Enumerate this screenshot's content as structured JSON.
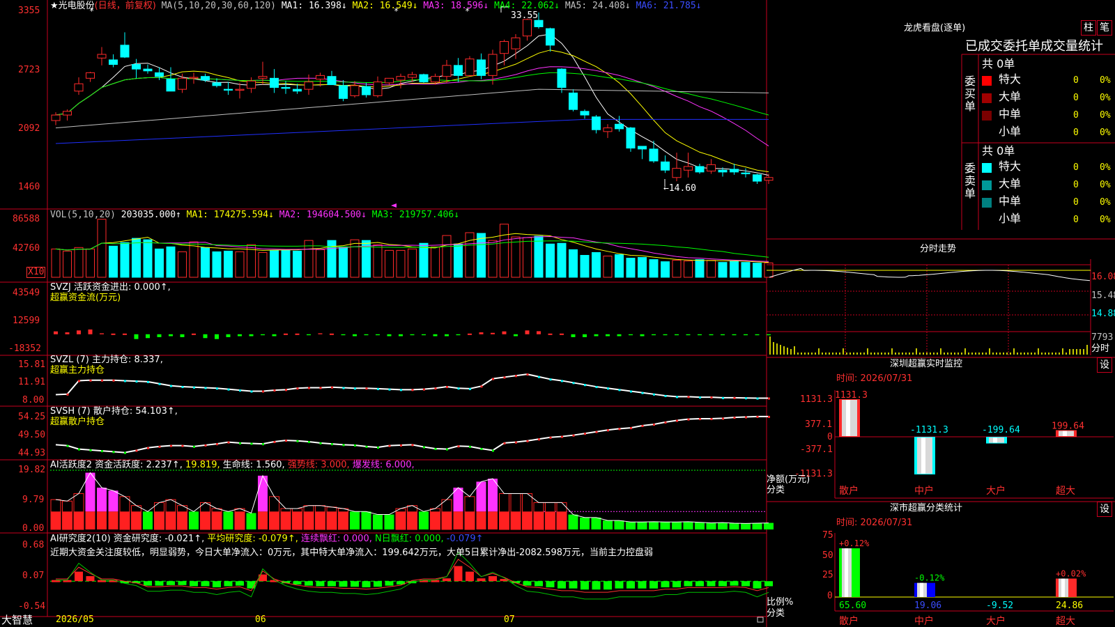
{
  "colors": {
    "up": "#ff2a2a",
    "down": "#00ffff",
    "vol_up": "#ff2a2a",
    "ma1": "#ffffff",
    "ma2": "#ffff00",
    "ma3": "#ff33ff",
    "ma4": "#00ff00",
    "ma5": "#c0c0c0",
    "ma6": "#2030ff",
    "grid": "#c8001e",
    "buy_super": "#ff0000",
    "buy_big": "#a00000",
    "buy_mid": "#7a0000",
    "sell_super": "#00ffff",
    "sell_big": "#009999",
    "sell_mid": "#008080"
  },
  "header": {
    "stock": "★光电股份",
    "mode": "(日线，前复权)",
    "ma_label": "MA(5,10,20,30,60,120)",
    "ma1": "MA1: 16.398↓",
    "ma2": "MA2: 16.549↓",
    "ma3": "MA3: 18.596↓",
    "ma4": "MA4: 22.062↓",
    "ma5": "MA5: 24.408↓",
    "ma6": "MA6: 21.785↓"
  },
  "price_axis": [
    "3355",
    "2723",
    "2092",
    "1460"
  ],
  "annotations": {
    "high": "33.55",
    "low": "←14.60"
  },
  "vol_header": {
    "label": "VOL(5,10,20)",
    "value": "203035.000↑",
    "ma1": "MA1: 174275.594↓",
    "ma2": "MA2: 194604.500↓",
    "ma3": "MA3: 219757.406↓"
  },
  "vol_axis": [
    "86588",
    "42760"
  ],
  "vol_unit": "X10",
  "svzj": {
    "line1": "SVZJ  活跃资金进出: 0.000↑,",
    "line2": "超赢资金流(万元)",
    "axis": [
      "43549",
      "12599",
      "-18352"
    ]
  },
  "svzl": {
    "line1": "SVZL (7) 主力持仓: 8.337,",
    "line2": "超赢主力持仓",
    "axis": [
      "15.81",
      "11.91",
      "8.00"
    ]
  },
  "svsh": {
    "line1": "SVSH (7) 散户持仓: 54.103↑,",
    "line2": "超赢散户持仓",
    "axis": [
      "54.25",
      "49.50",
      "44.93"
    ]
  },
  "ai2": {
    "a": "AI活跃度2 资金活跃度: 2.237↑,",
    "b": "19.819,",
    "c": "生命线: 1.560,",
    "d": "强势线: 3.000,",
    "e": "爆发线: 6.000,",
    "axis": [
      "19.82",
      "9.79",
      "0.00"
    ]
  },
  "ai_res": {
    "a": "AI研究度2(10) 资金研究度: -0.021↑,",
    "b": "平均研究度: -0.079↑,",
    "c": "连续飘红: 0.000,",
    "d": "N日飘红: 0.000,",
    "e": "-0.079↑",
    "comment": "近期大资金关注度较低，明显弱势，今日大单净流入：0万元，其中特大单净流入：199.642万元，大单5日累计净出-2082.598万元，当前主力控盘弱",
    "axis": [
      "0.68",
      "0.07",
      "-0.54"
    ]
  },
  "date_axis": {
    "brand": "大智慧",
    "labels": [
      "2026/05",
      "06",
      "07"
    ]
  },
  "right": {
    "lhb_title": "龙虎看盘(逐单)",
    "btn_zhu": "柱",
    "btn_bi": "笔",
    "tabs": "已成交委托单成交量统计",
    "buy_side": "委买单",
    "sell_side": "委卖单",
    "buy_total": "共 0单",
    "sell_total": "共 0单",
    "buy_rows": [
      {
        "name": "特大",
        "v": "0",
        "p": "0%"
      },
      {
        "name": "大单",
        "v": "0",
        "p": "0%"
      },
      {
        "name": "中单",
        "v": "0",
        "p": "0%"
      },
      {
        "name": "小单",
        "v": "0",
        "p": "0%"
      }
    ],
    "sell_rows": [
      {
        "name": "特大",
        "v": "0",
        "p": "0%"
      },
      {
        "name": "大单",
        "v": "0",
        "p": "0%"
      },
      {
        "name": "中单",
        "v": "0",
        "p": "0%"
      },
      {
        "name": "小单",
        "v": "0",
        "p": "0%"
      }
    ],
    "intraday_title": "分时走势",
    "intraday_axis": [
      "16.08",
      "15.48",
      "14.88",
      "7793",
      "分时"
    ],
    "sz_title": "深圳超赢实时监控",
    "sz_btn": "设",
    "sz_time": "时间: 2026/07/31",
    "sz_axis": [
      "1131.3",
      "377.1",
      "0",
      "-377.1",
      "-1131.3"
    ],
    "sz_ylabel": "净额(万元)",
    "sz_xlabel": "分类",
    "sz_bars": [
      {
        "cat": "散户",
        "value": 1131.3,
        "label": "1131.3"
      },
      {
        "cat": "中户",
        "value": -1131.3,
        "label": "-1131.3"
      },
      {
        "cat": "大户",
        "value": -199.64,
        "label": "-199.64"
      },
      {
        "cat": "超大",
        "value": 199.64,
        "label": "199.64"
      }
    ],
    "ss_title": "深市超赢分类统计",
    "ss_btn": "设",
    "ss_time": "时间: 2026/07/31",
    "ss_axis": [
      "75",
      "50",
      "25",
      "0"
    ],
    "ss_ylabel": "比例%",
    "ss_xlabel": "分类",
    "ss_bars": [
      {
        "cat": "散户",
        "value": 65.6,
        "label": "65.60",
        "delta": "+0.12%"
      },
      {
        "cat": "中户",
        "value": 19.06,
        "label": "19.06",
        "delta": "-0.12%"
      },
      {
        "cat": "大户",
        "value": -9.52,
        "label": "-9.52",
        "delta": ""
      },
      {
        "cat": "超大",
        "value": 24.86,
        "label": "24.86",
        "delta": "+0.02%"
      }
    ]
  },
  "chart_data": [
    {
      "type": "candlestick",
      "title": "光电股份 日线 前复权",
      "ylim": [
        14.6,
        33.55
      ],
      "high": 33.55,
      "low": 14.6,
      "ohlc": [
        [
          21.8,
          22.7,
          21.3,
          22.4
        ],
        [
          22.4,
          23.0,
          21.8,
          22.8
        ],
        [
          25.0,
          26.5,
          24.6,
          25.8
        ],
        [
          26.4,
          27.1,
          26.0,
          27.0
        ],
        [
          28.6,
          29.8,
          27.8,
          29.0
        ],
        [
          28.4,
          29.0,
          27.6,
          27.9
        ],
        [
          30.0,
          31.4,
          28.6,
          28.7
        ],
        [
          27.9,
          28.5,
          26.4,
          27.4
        ],
        [
          27.4,
          27.9,
          26.9,
          27.2
        ],
        [
          27.0,
          27.6,
          26.2,
          26.6
        ],
        [
          26.3,
          27.6,
          25.0,
          25.0
        ],
        [
          25.2,
          26.9,
          24.8,
          26.4
        ],
        [
          26.4,
          27.0,
          25.8,
          26.5
        ],
        [
          26.6,
          26.9,
          26.0,
          26.2
        ],
        [
          25.9,
          26.4,
          25.4,
          25.6
        ],
        [
          25.2,
          26.0,
          24.6,
          25.1
        ],
        [
          25.1,
          25.9,
          24.2,
          25.2
        ],
        [
          25.3,
          26.5,
          24.8,
          26.1
        ],
        [
          26.4,
          28.2,
          25.7,
          26.6
        ],
        [
          26.4,
          27.4,
          24.8,
          25.4
        ],
        [
          25.4,
          26.1,
          24.7,
          25.3
        ],
        [
          25.2,
          25.8,
          24.7,
          25.0
        ],
        [
          25.2,
          26.8,
          24.6,
          26.0
        ],
        [
          26.3,
          27.0,
          25.5,
          26.7
        ],
        [
          26.6,
          27.2,
          25.7,
          25.7
        ],
        [
          25.6,
          26.2,
          23.9,
          24.2
        ],
        [
          24.5,
          26.1,
          24.3,
          25.6
        ],
        [
          25.5,
          25.9,
          24.3,
          24.6
        ],
        [
          24.5,
          26.6,
          24.3,
          26.0
        ],
        [
          25.9,
          26.4,
          25.7,
          26.4
        ],
        [
          26.2,
          26.9,
          25.3,
          26.6
        ],
        [
          26.5,
          27.1,
          26.0,
          26.8
        ],
        [
          26.8,
          26.9,
          25.9,
          26.0
        ],
        [
          26.0,
          26.9,
          25.7,
          26.6
        ],
        [
          26.6,
          28.4,
          25.9,
          27.8
        ],
        [
          27.8,
          28.6,
          26.0,
          26.7
        ],
        [
          26.7,
          28.8,
          26.6,
          28.5
        ],
        [
          28.4,
          29.1,
          26.3,
          26.7
        ],
        [
          26.7,
          29.5,
          25.7,
          29.0
        ],
        [
          29.1,
          30.6,
          27.8,
          30.4
        ],
        [
          29.6,
          31.2,
          28.5,
          30.8
        ],
        [
          31.0,
          32.9,
          30.5,
          32.8
        ],
        [
          32.7,
          33.55,
          31.8,
          32.0
        ],
        [
          31.8,
          31.9,
          29.3,
          30.0
        ],
        [
          27.4,
          27.5,
          24.8,
          25.4
        ],
        [
          24.8,
          25.2,
          22.8,
          23.0
        ],
        [
          22.8,
          23.0,
          22.0,
          22.4
        ],
        [
          22.2,
          22.4,
          20.4,
          20.8
        ],
        [
          20.6,
          21.4,
          19.9,
          21.0
        ],
        [
          21.4,
          22.3,
          20.6,
          20.9
        ],
        [
          21.0,
          21.1,
          18.4,
          18.8
        ],
        [
          19.0,
          19.0,
          17.6,
          18.7
        ],
        [
          18.7,
          19.6,
          17.2,
          17.4
        ],
        [
          17.3,
          18.0,
          16.1,
          16.4
        ],
        [
          15.6,
          18.3,
          15.2,
          16.6
        ],
        [
          16.4,
          18.3,
          15.6,
          16.8
        ],
        [
          16.8,
          17.1,
          16.0,
          16.2
        ],
        [
          16.3,
          17.6,
          16.0,
          17.0
        ],
        [
          16.4,
          16.7,
          15.7,
          16.2
        ],
        [
          16.5,
          17.1,
          15.9,
          16.2
        ],
        [
          16.1,
          16.6,
          15.6,
          16.0
        ],
        [
          15.9,
          16.0,
          14.9,
          15.2
        ],
        [
          15.3,
          16.0,
          14.9,
          15.6
        ]
      ],
      "ma": {
        "MA1": 16.398,
        "MA2": 16.549,
        "MA3": 18.596,
        "MA4": 22.062,
        "MA5": 24.408,
        "MA6": 21.785
      }
    },
    {
      "type": "bar",
      "title": "VOL(5,10,20)",
      "unit": "X10",
      "ylim": [
        0,
        86588
      ],
      "values": [
        40000,
        37000,
        42000,
        40000,
        82000,
        44000,
        49000,
        55000,
        53000,
        40000,
        43000,
        36000,
        50000,
        42000,
        36000,
        37000,
        36000,
        46000,
        35000,
        38000,
        38000,
        37000,
        52000,
        39000,
        52000,
        43000,
        53000,
        52000,
        46000,
        38000,
        38000,
        40000,
        48000,
        43000,
        59000,
        47000,
        63000,
        62000,
        52000,
        75000,
        57000,
        56000,
        58000,
        47000,
        48000,
        39000,
        31000,
        35000,
        30000,
        32000,
        27000,
        28000,
        25000,
        22000,
        24000,
        23000,
        25000,
        24000,
        21000,
        23000,
        21000,
        20000,
        20300
      ]
    },
    {
      "type": "bar",
      "title": "超赢资金流(万元)",
      "ylim": [
        -18352,
        43549
      ],
      "values": [
        3000,
        2000,
        4000,
        5000,
        1000,
        0,
        0,
        -5000,
        -4000,
        -3000,
        -2000,
        -3000,
        0,
        -4000,
        -5000,
        -3000,
        -2000,
        -2000,
        -1000,
        -2000,
        0,
        0,
        -1000,
        1000,
        0,
        -1000,
        -2000,
        -1000,
        -1000,
        -2000,
        -2000,
        -1000,
        -1000,
        -2000,
        -2000,
        -1000,
        0,
        2000,
        1500,
        3000,
        -2000,
        4000,
        3200,
        0,
        0,
        -3000,
        -3000,
        -2000,
        -2000,
        -2000,
        -1000,
        -2000,
        -1000,
        -1000,
        -1000,
        -1000,
        -1000,
        -1000,
        -1000,
        -1000,
        -1000,
        -1000,
        -1000
      ]
    },
    {
      "type": "line",
      "title": "超赢主力持仓",
      "ylim": [
        8.0,
        15.81
      ],
      "values": [
        9.6,
        9.7,
        12.4,
        12.5,
        12.5,
        12.5,
        12.4,
        12.3,
        12.2,
        11.8,
        11.4,
        11.2,
        11.1,
        11.0,
        10.9,
        10.7,
        10.5,
        10.3,
        10.3,
        10.5,
        10.6,
        10.9,
        11.0,
        11.0,
        11.1,
        11.0,
        10.9,
        10.9,
        10.8,
        10.7,
        10.6,
        10.6,
        10.7,
        10.9,
        11.2,
        10.9,
        10.8,
        11.3,
        12.8,
        13.1,
        13.4,
        13.7,
        13.2,
        12.7,
        12.4,
        12.0,
        11.6,
        11.2,
        10.9,
        10.6,
        10.3,
        10.0,
        9.7,
        9.4,
        9.2,
        9.2,
        9.1,
        9.1,
        9.0,
        9.0,
        8.95,
        8.9,
        8.9
      ]
    },
    {
      "type": "line",
      "title": "超赢散户持仓",
      "ylim": [
        44.93,
        54.25
      ],
      "values": [
        47.6,
        47.4,
        46.6,
        46.4,
        46.2,
        46.0,
        45.8,
        46.3,
        46.9,
        47.2,
        47.4,
        47.4,
        47.2,
        47.5,
        47.8,
        48.2,
        48.0,
        47.9,
        47.8,
        48.3,
        48.6,
        48.5,
        48.3,
        48.0,
        47.8,
        47.6,
        47.5,
        47.2,
        47.0,
        47.4,
        47.5,
        47.6,
        47.1,
        46.7,
        46.6,
        47.3,
        47.2,
        46.7,
        46.3,
        48.0,
        48.2,
        48.5,
        48.9,
        49.3,
        49.5,
        49.8,
        50.2,
        50.6,
        51.0,
        51.3,
        51.5,
        52.0,
        52.3,
        52.8,
        53.2,
        53.5,
        53.6,
        53.6,
        53.7,
        53.9,
        54.0,
        54.1,
        54.1
      ]
    },
    {
      "type": "bar",
      "title": "AI活跃度2",
      "ylim": [
        0,
        19.82
      ],
      "values": [
        10,
        9.5,
        12,
        19,
        14,
        13,
        11,
        8,
        6,
        9,
        10,
        8,
        6,
        9,
        7,
        6,
        7,
        5.5,
        18,
        11,
        7,
        7,
        8,
        8,
        7.5,
        7,
        6,
        6,
        5,
        5,
        7,
        8,
        6,
        7,
        10,
        14,
        11,
        16,
        17,
        12,
        12,
        12,
        9,
        9,
        9,
        5,
        4,
        4,
        3,
        3,
        2.5,
        2.5,
        2.6,
        2.5,
        2.5,
        2.6,
        2.4,
        2.2,
        2.3,
        2.1,
        2.0,
        2.1,
        2.2
      ]
    },
    {
      "type": "bar",
      "title": "AI研究度2(10)",
      "ylim": [
        -0.54,
        0.68
      ],
      "values": [
        0.05,
        0.05,
        0.2,
        0.12,
        0.05,
        0.05,
        0.02,
        0.0,
        -0.05,
        -0.05,
        -0.04,
        -0.04,
        -0.06,
        -0.06,
        -0.08,
        -0.06,
        -0.05,
        -0.1,
        0.15,
        0.05,
        0.0,
        -0.03,
        -0.05,
        -0.06,
        -0.06,
        -0.07,
        -0.07,
        -0.08,
        -0.07,
        -0.05,
        -0.03,
        0.03,
        0.05,
        0.05,
        0.08,
        0.3,
        0.2,
        0.08,
        0.12,
        0.07,
        0.0,
        -0.05,
        -0.06,
        -0.08,
        -0.1,
        -0.1,
        -0.12,
        -0.12,
        -0.12,
        -0.1,
        -0.1,
        -0.1,
        -0.1,
        -0.08,
        -0.08,
        -0.06,
        -0.06,
        -0.06,
        -0.06,
        -0.05,
        -0.06,
        -0.1,
        -0.06
      ]
    }
  ]
}
